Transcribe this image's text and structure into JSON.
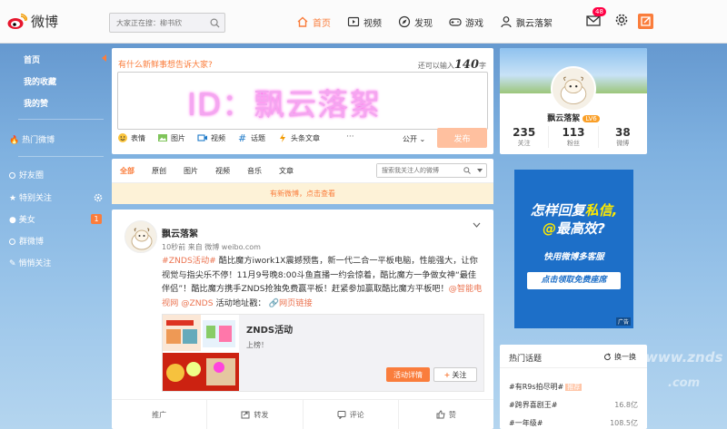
{
  "topbar": {
    "logo_text": "微博",
    "search_placeholder": "大家正在搜：柳书欣",
    "nav": [
      {
        "label": "首页",
        "icon": "home-icon",
        "active": true
      },
      {
        "label": "视频",
        "icon": "video-icon"
      },
      {
        "label": "发现",
        "icon": "discover-icon"
      },
      {
        "label": "游戏",
        "icon": "game-icon"
      },
      {
        "label": "飘云落絮",
        "icon": "user-icon"
      }
    ],
    "mail_badge": "48",
    "accent": "#fa7d3c"
  },
  "sidebar": {
    "items": [
      {
        "label": "首页"
      },
      {
        "label": "我的收藏"
      },
      {
        "label": "我的赞"
      },
      {
        "label": "热门微博"
      },
      {
        "label": "好友圈"
      },
      {
        "label": "特别关注"
      },
      {
        "label": "美女",
        "count": "1"
      },
      {
        "label": "群微博"
      },
      {
        "label": "悄悄关注"
      }
    ]
  },
  "publish": {
    "prompt": "有什么新鲜事想告诉大家?",
    "limit_prefix": "还可以输入",
    "limit_num": "140",
    "limit_suffix": "字",
    "overlay_text": "ID：飘云落絮",
    "tools": [
      {
        "label": "表情",
        "icon": "emoji-icon"
      },
      {
        "label": "图片",
        "icon": "image-icon"
      },
      {
        "label": "视频",
        "icon": "video-icon"
      },
      {
        "label": "话题",
        "icon": "topic-icon"
      },
      {
        "label": "头条文章",
        "icon": "article-icon"
      }
    ],
    "more": "···",
    "visibility": "公开",
    "submit": "发布"
  },
  "filter": {
    "tabs": [
      "全部",
      "原创",
      "图片",
      "视频",
      "音乐",
      "文章"
    ],
    "search_placeholder": "搜索我关注人的微博"
  },
  "newfeed_notice": "有新微博，点击查看",
  "post": {
    "author": "飘云落絮",
    "meta": "10秒前 来自 微博 weibo.com",
    "hashtag": "#ZNDS活动#",
    "body": " 酷比魔方iwork1X震撼预售，新一代二合一平板电脑，性能强大，让你视觉与指尖乐不停！11月9号晚8:00斗鱼直播一约会惊着，酷比魔方一争做女神“最佳伴侣”！酷比魔方携手ZNDS抢独免费赢平板！赶紧参加赢取酷比魔方平板吧！",
    "mention": "@智能电视网 @ZNDS",
    "link_prefix": " 活动地址戳：",
    "link": "网页链接",
    "share": {
      "title": "ZNDS活动",
      "sub": "上榜！",
      "btn_detail": "活动详情",
      "btn_follow": "关注"
    },
    "actions": [
      {
        "label": "推广",
        "icon": ""
      },
      {
        "label": "转发",
        "icon": "repost-icon"
      },
      {
        "label": "评论",
        "icon": "comment-icon"
      },
      {
        "label": "赞",
        "icon": "like-icon"
      }
    ]
  },
  "profile": {
    "name": "飘云落絮",
    "level": "LV6",
    "stats": [
      {
        "num": "235",
        "label": "关注"
      },
      {
        "num": "113",
        "label": "粉丝"
      },
      {
        "num": "38",
        "label": "微博"
      }
    ]
  },
  "ad": {
    "line1a": "怎样回复",
    "line1b": "私信,",
    "line2a": "@",
    "line2b": "最高效?",
    "line3": "快用微博多客服",
    "button": "点击领取免费座席",
    "tag": "广告"
  },
  "hot": {
    "title": "热门话题",
    "refresh": "换一换",
    "items": [
      {
        "label": "#有R9s拍尽明#",
        "count": "",
        "tag": "推荐"
      },
      {
        "label": "#跨界喜剧王#",
        "count": "16.8亿"
      },
      {
        "label": "#一年级#",
        "count": "108.5亿"
      }
    ]
  },
  "watermark": {
    "a": "www.znds",
    "b": ".com"
  }
}
